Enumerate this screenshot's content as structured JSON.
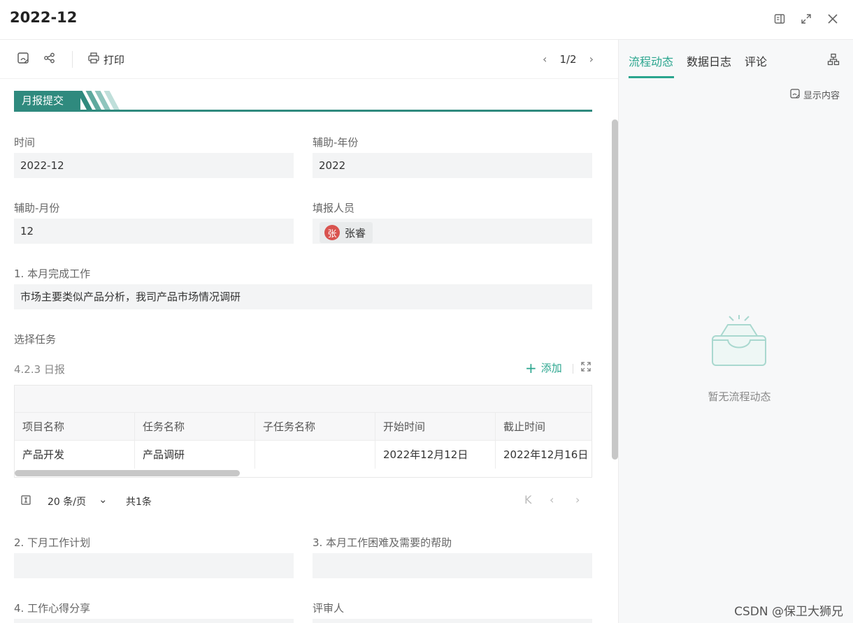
{
  "window": {
    "title": "2022-12"
  },
  "toolbar": {
    "print_label": "打印",
    "pager": "1/2"
  },
  "section": {
    "title": "月报提交"
  },
  "form": {
    "time_label": "时间",
    "time_value": "2022-12",
    "year_label": "辅助-年份",
    "year_value": "2022",
    "month_label": "辅助-月份",
    "month_value": "12",
    "reporter_label": "填报人员",
    "reporter_avatar": "张",
    "reporter_name": "张睿",
    "work_label": "1. 本月完成工作",
    "work_value": "市场主要类似产品分析，我司产品市场情况调研",
    "task_label": "选择任务",
    "task_sub_label": "4.2.3 日报",
    "add_label": "添加",
    "next_plan_label": "2. 下月工作计划",
    "difficulty_label": "3. 本月工作困难及需要的帮助",
    "experience_label": "4. 工作心得分享",
    "reviewer_label": "评审人"
  },
  "table": {
    "columns": [
      "项目名称",
      "任务名称",
      "子任务名称",
      "开始时间",
      "截止时间"
    ],
    "rows": [
      [
        "产品开发",
        "产品调研",
        "",
        "2022年12月12日",
        "2022年12月16日"
      ]
    ],
    "page_size": "20 条/页",
    "total": "共1条"
  },
  "right_panel": {
    "tabs": [
      "流程动态",
      "数据日志",
      "评论"
    ],
    "active_tab": 0,
    "show_content": "显示内容",
    "empty_text": "暂无流程动态"
  },
  "watermark": "CSDN @保卫大狮兄",
  "colors": {
    "accent": "#2aa58e",
    "section": "#2f8a7e",
    "avatar": "#d9534f"
  }
}
